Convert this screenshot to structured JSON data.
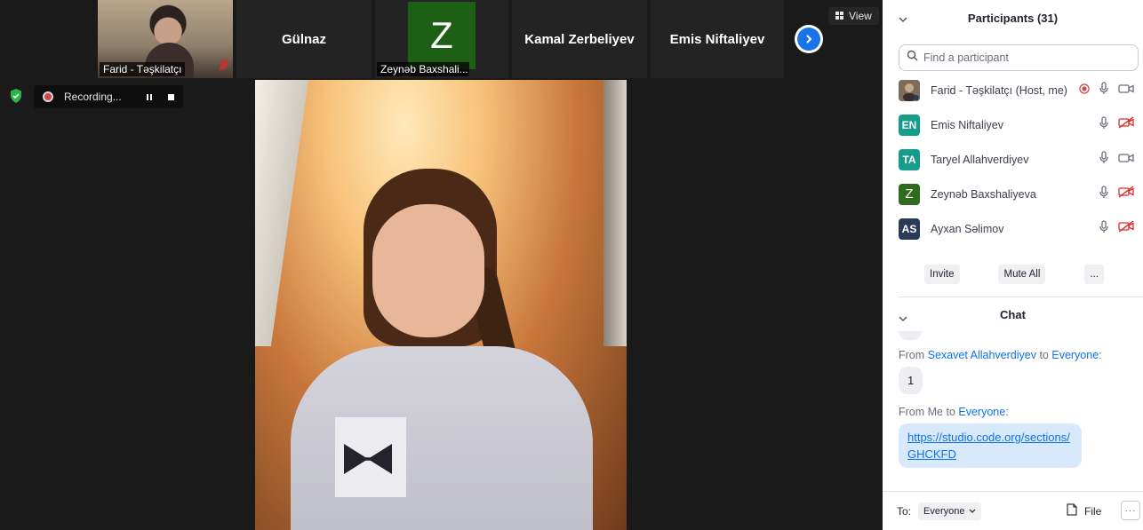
{
  "thumbnails": [
    {
      "kind": "camera",
      "caption": "Farid - Təşkilatçı"
    },
    {
      "kind": "name",
      "name": "Gülnaz"
    },
    {
      "kind": "avatar",
      "letter": "Z",
      "caption": "Zeynəb Baxshali...",
      "color": "#1e5f16"
    },
    {
      "kind": "name",
      "name": "Kamal Zerbeliyev"
    },
    {
      "kind": "name",
      "name": "Emis Niftaliyev"
    }
  ],
  "view_button": {
    "label": "View",
    "icon": "grid-icon"
  },
  "recording": {
    "label": "Recording..."
  },
  "participants": {
    "title": "Participants (31)",
    "search_placeholder": "Find a participant",
    "list": [
      {
        "initials": "",
        "name": "Farid - Təşkilatçı (Host, me)",
        "avatar_color": "",
        "mic": "on",
        "video": "on",
        "recording": true
      },
      {
        "initials": "EN",
        "name": "Emis Niftaliyev",
        "avatar_color": "#159c8a",
        "mic": "on",
        "video": "off",
        "recording": false
      },
      {
        "initials": "TA",
        "name": "Taryel Allahverdiyev",
        "avatar_color": "#159c8a",
        "mic": "on",
        "video": "on",
        "recording": false
      },
      {
        "initials": "Z",
        "name": "Zeynəb Baxshaliyeva",
        "avatar_color": "#2e6b1f",
        "mic": "on",
        "video": "off",
        "recording": false
      },
      {
        "initials": "AS",
        "name": "Ayxan Səlimov",
        "avatar_color": "#2b3a57",
        "mic": "on",
        "video": "off",
        "recording": false
      }
    ],
    "actions": {
      "invite": "Invite",
      "mute_all": "Mute All",
      "more": "..."
    }
  },
  "chat": {
    "title": "Chat",
    "messages": [
      {
        "from_prefix": "From",
        "sender": "Sexavet Allahverdiyev",
        "to_word": "to",
        "recipient": "Everyone",
        "colon": ":",
        "text": "1"
      },
      {
        "from_prefix": "From Me to",
        "recipient": "Everyone",
        "colon": ":",
        "link": "https://studio.code.org/sections/GHCKFD"
      }
    ],
    "footer": {
      "to_label": "To:",
      "to_value": "Everyone",
      "file_label": "File",
      "more_label": "···"
    }
  },
  "colors": {
    "zoom_blue": "#0e71eb",
    "recording_red": "#d64646",
    "muted_red": "#e02828",
    "panel_bg": "#ffffff",
    "video_bg": "#1a1a1a"
  }
}
